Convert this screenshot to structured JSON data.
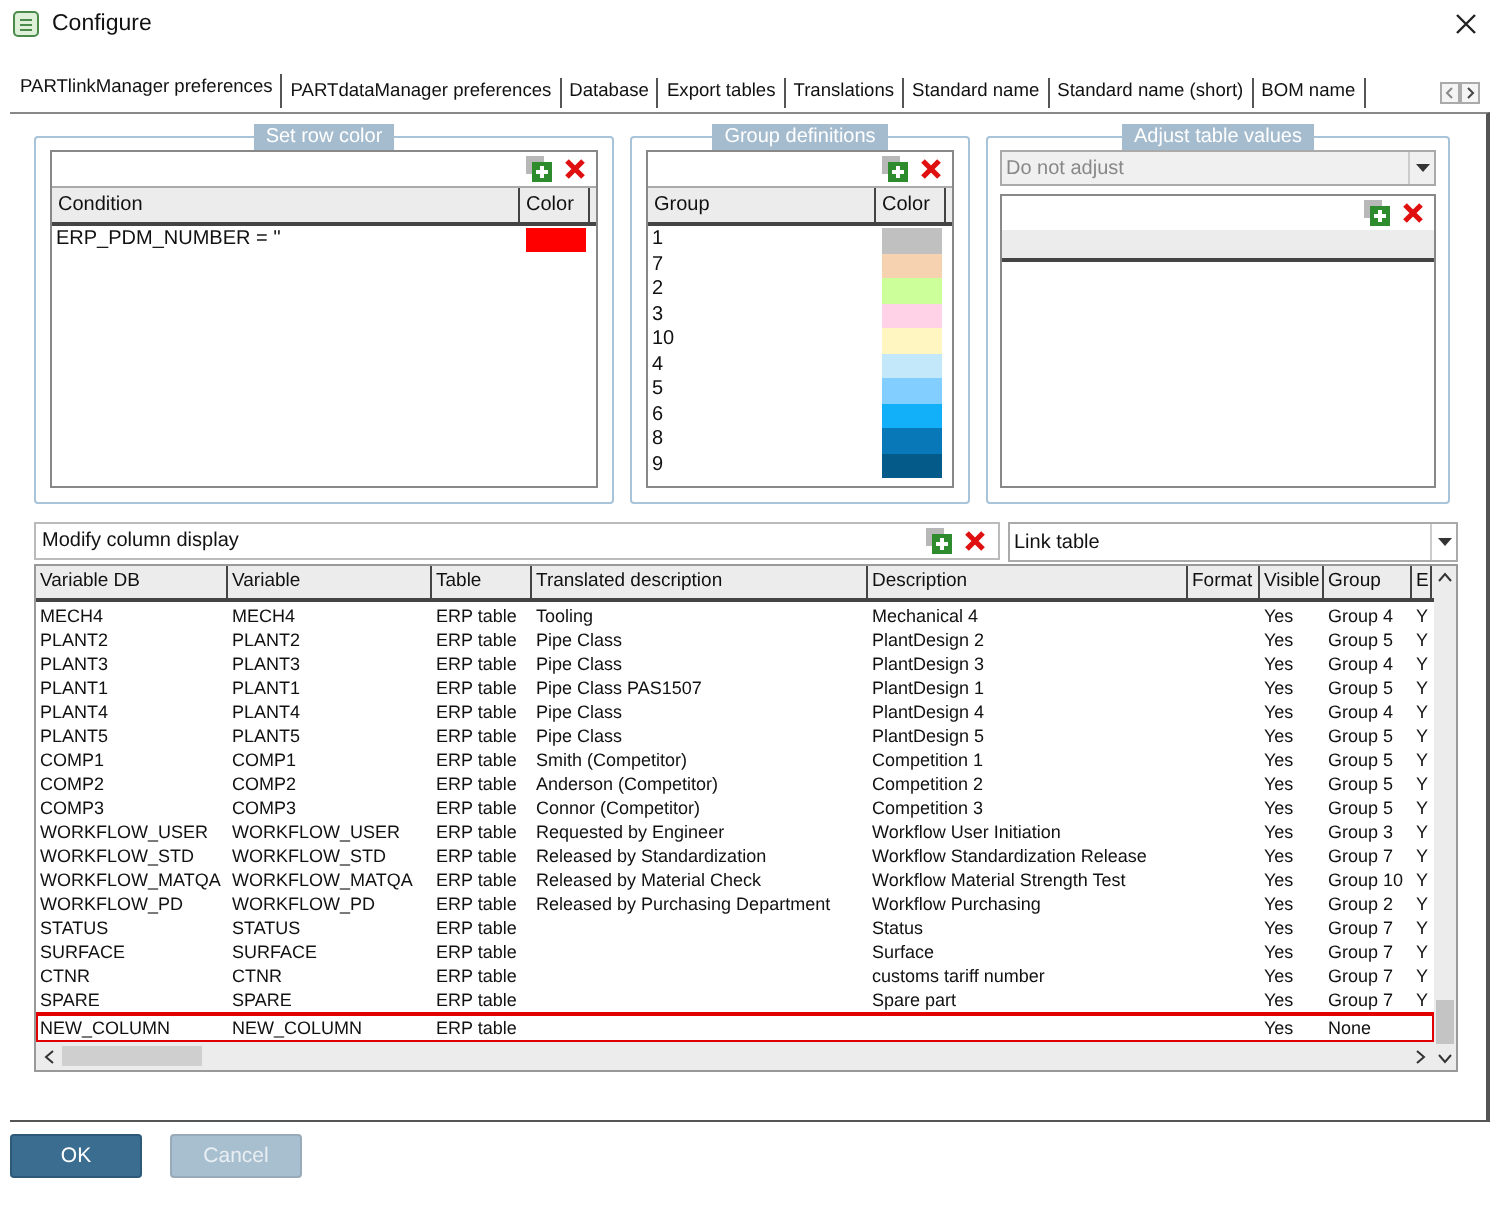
{
  "window": {
    "title": "Configure"
  },
  "tabs": [
    {
      "label": "PARTlinkManager preferences",
      "selected": true
    },
    {
      "label": "PARTdataManager preferences",
      "selected": false
    },
    {
      "label": "Database",
      "selected": false
    },
    {
      "label": "Export tables",
      "selected": false
    },
    {
      "label": "Translations",
      "selected": false
    },
    {
      "label": "Standard name",
      "selected": false
    },
    {
      "label": "Standard name (short)",
      "selected": false
    },
    {
      "label": "BOM name",
      "selected": false
    }
  ],
  "row_color": {
    "title": "Set row color",
    "columns": [
      "Condition",
      "Color"
    ],
    "rows": [
      {
        "condition": "ERP_PDM_NUMBER = ''",
        "color": "#ff0000"
      }
    ]
  },
  "group_definitions": {
    "title": "Group definitions",
    "columns": [
      "Group",
      "Color"
    ],
    "rows": [
      {
        "group": "1",
        "color": "#c0c0c0"
      },
      {
        "group": "7",
        "color": "#f6d2b0"
      },
      {
        "group": "2",
        "color": "#ccff99"
      },
      {
        "group": "3",
        "color": "#ffd2e8"
      },
      {
        "group": "10",
        "color": "#fff6c2"
      },
      {
        "group": "4",
        "color": "#c2e8fa"
      },
      {
        "group": "5",
        "color": "#82cfff"
      },
      {
        "group": "6",
        "color": "#12b0f8"
      },
      {
        "group": "8",
        "color": "#0878b8"
      },
      {
        "group": "9",
        "color": "#045a88"
      }
    ]
  },
  "adjust_table_values": {
    "title": "Adjust table values",
    "dropdown": {
      "value": "Do not adjust",
      "disabled": true
    }
  },
  "column_display": {
    "title": "Modify column display",
    "table_dropdown": {
      "value": "Link table"
    },
    "columns": [
      "Variable DB",
      "Variable",
      "Table",
      "Translated description",
      "Description",
      "Format",
      "Visible",
      "Group",
      "E"
    ],
    "rows": [
      {
        "cells": [
          "MECH4",
          "MECH4",
          "ERP table",
          "Tooling",
          "Mechanical 4",
          "",
          "Yes",
          "Group 4",
          "Y"
        ],
        "highlighted": false
      },
      {
        "cells": [
          "PLANT2",
          "PLANT2",
          "ERP table",
          "Pipe Class",
          "PlantDesign 2",
          "",
          "Yes",
          "Group 5",
          "Y"
        ],
        "highlighted": false
      },
      {
        "cells": [
          "PLANT3",
          "PLANT3",
          "ERP table",
          "Pipe Class",
          "PlantDesign 3",
          "",
          "Yes",
          "Group 4",
          "Y"
        ],
        "highlighted": false
      },
      {
        "cells": [
          "PLANT1",
          "PLANT1",
          "ERP table",
          "Pipe Class PAS1507",
          "PlantDesign 1",
          "",
          "Yes",
          "Group 5",
          "Y"
        ],
        "highlighted": false
      },
      {
        "cells": [
          "PLANT4",
          "PLANT4",
          "ERP table",
          "Pipe Class",
          "PlantDesign 4",
          "",
          "Yes",
          "Group 4",
          "Y"
        ],
        "highlighted": false
      },
      {
        "cells": [
          "PLANT5",
          "PLANT5",
          "ERP table",
          "Pipe Class",
          "PlantDesign 5",
          "",
          "Yes",
          "Group 5",
          "Y"
        ],
        "highlighted": false
      },
      {
        "cells": [
          "COMP1",
          "COMP1",
          "ERP table",
          "Smith (Competitor)",
          "Competition 1",
          "",
          "Yes",
          "Group 5",
          "Y"
        ],
        "highlighted": false
      },
      {
        "cells": [
          "COMP2",
          "COMP2",
          "ERP table",
          "Anderson (Competitor)",
          "Competition 2",
          "",
          "Yes",
          "Group 5",
          "Y"
        ],
        "highlighted": false
      },
      {
        "cells": [
          "COMP3",
          "COMP3",
          "ERP table",
          "Connor (Competitor)",
          "Competition 3",
          "",
          "Yes",
          "Group 5",
          "Y"
        ],
        "highlighted": false
      },
      {
        "cells": [
          "WORKFLOW_USER",
          "WORKFLOW_USER",
          "ERP table",
          "Requested by Engineer",
          "Workflow User Initiation",
          "",
          "Yes",
          "Group 3",
          "Y"
        ],
        "highlighted": false
      },
      {
        "cells": [
          "WORKFLOW_STD",
          "WORKFLOW_STD",
          "ERP table",
          "Released by Standardization",
          "Workflow Standardization Release",
          "",
          "Yes",
          "Group 7",
          "Y"
        ],
        "highlighted": false
      },
      {
        "cells": [
          "WORKFLOW_MATQA",
          "WORKFLOW_MATQA",
          "ERP table",
          "Released by Material Check",
          "Workflow Material Strength Test",
          "",
          "Yes",
          "Group 10",
          "Y"
        ],
        "highlighted": false
      },
      {
        "cells": [
          "WORKFLOW_PD",
          "WORKFLOW_PD",
          "ERP table",
          "Released by Purchasing Department",
          "Workflow Purchasing",
          "",
          "Yes",
          "Group 2",
          "Y"
        ],
        "highlighted": false
      },
      {
        "cells": [
          "STATUS",
          "STATUS",
          "ERP table",
          "",
          "Status",
          "",
          "Yes",
          "Group 7",
          "Y"
        ],
        "highlighted": false
      },
      {
        "cells": [
          "SURFACE",
          "SURFACE",
          "ERP table",
          "",
          "Surface",
          "",
          "Yes",
          "Group 7",
          "Y"
        ],
        "highlighted": false
      },
      {
        "cells": [
          "CTNR",
          "CTNR",
          "ERP table",
          "",
          "customs tariff number",
          "",
          "Yes",
          "Group 7",
          "Y"
        ],
        "highlighted": false
      },
      {
        "cells": [
          "SPARE",
          "SPARE",
          "ERP table",
          "",
          "Spare part",
          "",
          "Yes",
          "Group 7",
          "Y"
        ],
        "highlighted": false
      },
      {
        "cells": [
          "NEW_COLUMN",
          "NEW_COLUMN",
          "ERP table",
          "",
          "",
          "",
          "Yes",
          "None"
        ],
        "highlighted": true
      }
    ]
  },
  "buttons": [
    {
      "label": "OK",
      "disabled": false
    },
    {
      "label": "Cancel",
      "disabled": true
    }
  ]
}
